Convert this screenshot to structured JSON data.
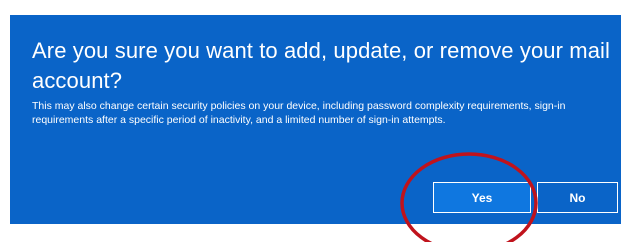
{
  "dialog": {
    "title": "Are you sure you want to add, update, or remove your mail account?",
    "message": "This may also change certain security policies on your device, including password complexity requirements, sign-in requirements after a specific period of inactivity, and a limited number of sign-in attempts.",
    "yes_label": "Yes",
    "no_label": "No"
  },
  "colors": {
    "dialog_background": "#0a64c8",
    "primary_button": "#0f77e0",
    "text": "#ffffff",
    "annotation_circle": "#c0131c"
  }
}
